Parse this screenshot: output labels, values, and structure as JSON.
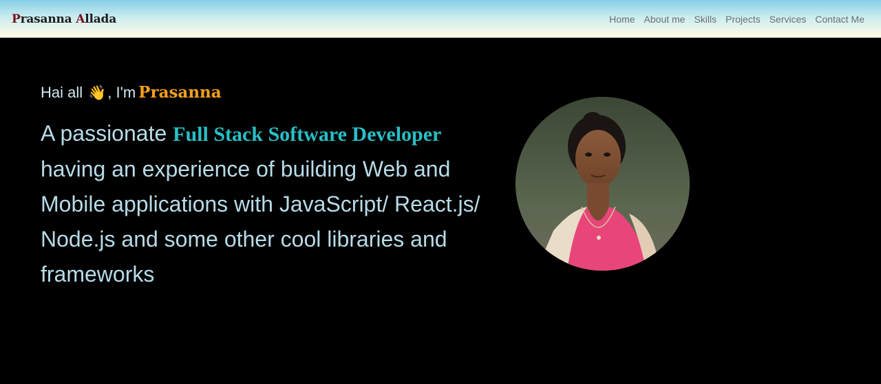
{
  "navbar": {
    "brand_first_initial": "P",
    "brand_first_rest": "rasanna ",
    "brand_last_initial": "A",
    "brand_last_rest": "llada",
    "links": [
      "Home",
      "About me",
      "Skills",
      "Projects",
      "Services",
      "Contact Me"
    ]
  },
  "hero": {
    "greeting_prefix": "Hai all",
    "wave_icon": "waving-hand-icon",
    "greeting_mid": ", I'm",
    "greeting_name": "Prasanna",
    "intro_prefix": "A passionate ",
    "intro_role": "Full Stack Software Developer",
    "intro_rest": " having an experience of building Web and Mobile applications with JavaScript/ React.js/ Node.js and some other cool libraries and frameworks"
  },
  "colors": {
    "accent_orange": "#f5a01a",
    "accent_teal": "#28bfc7",
    "brand_initial": "#7a0f1a"
  }
}
